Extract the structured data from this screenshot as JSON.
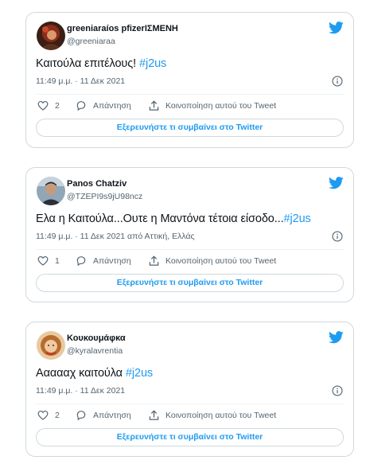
{
  "tweets": [
    {
      "name": "greeniaraíos pfizerΙΣΜΕΝΗ",
      "handle": "@greeniaraa",
      "text": "Καιτούλα επιτέλους! ",
      "hashtag": "#j2us",
      "time": "11:49 μ.μ. · 11 Δεκ 2021",
      "likes": "2",
      "reply": "Απάντηση",
      "share": "Κοινοποίηση αυτού του Tweet",
      "explore": "Εξερευνήστε τι συμβαίνει στο Twitter",
      "avatar_icon": "avatar-photo"
    },
    {
      "name": "Panos Chatziv",
      "handle": "@TZEPI9s9jU98ncz",
      "text": "Ελα η Καιτούλα...Ουτε η Μαντόνα τέτοια είσοδο...",
      "hashtag": "#j2us",
      "time": "11:49 μ.μ. · 11 Δεκ 2021 από Αττική, Ελλάς",
      "likes": "1",
      "reply": "Απάντηση",
      "share": "Κοινοποίηση αυτού του Tweet",
      "explore": "Εξερευνήστε τι συμβαίνει στο Twitter",
      "avatar_icon": "avatar-photo"
    },
    {
      "name": "Κουκουμάφκα",
      "handle": "@kyralavrentia",
      "text": "Αααααχ καιτούλα ",
      "hashtag": "#j2us",
      "time": "11:49 μ.μ. · 11 Δεκ 2021",
      "likes": "2",
      "reply": "Απάντηση",
      "share": "Κοινοποίηση αυτού του Tweet",
      "explore": "Εξερευνήστε τι συμβαίνει στο Twitter",
      "avatar_icon": "avatar-photo"
    }
  ],
  "colors": {
    "accent": "#1d9bf0",
    "text": "#0f1419",
    "muted": "#536471",
    "border": "#cfd9de"
  },
  "icons": [
    "twitter-bird-icon",
    "info-icon",
    "heart-icon",
    "reply-icon",
    "share-icon"
  ]
}
